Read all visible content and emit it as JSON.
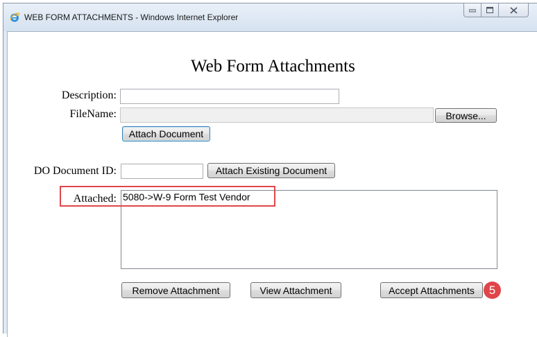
{
  "window": {
    "title": "WEB FORM ATTACHMENTS - Windows Internet Explorer",
    "app_icon": "internet-explorer-icon",
    "controls": [
      "minimize-icon",
      "maximize-icon",
      "close-icon"
    ]
  },
  "form": {
    "title": "Web Form Attachments",
    "description_label": "Description:",
    "description_value": "",
    "filename_label": "FileName:",
    "filename_value": "",
    "browse_button": "Browse...",
    "attach_button": "Attach Document",
    "do_document_label": "DO Document ID:",
    "do_document_value": "",
    "attach_existing_button": "Attach Existing Document",
    "attached_label": "Attached:",
    "attached_items": [
      "5080->W-9 Form Test Vendor"
    ],
    "remove_button": "Remove Attachment",
    "view_button": "View Attachment",
    "accept_button": "Accept Attachments"
  },
  "annotation": {
    "step_number": "5",
    "color": "#e0454a"
  }
}
